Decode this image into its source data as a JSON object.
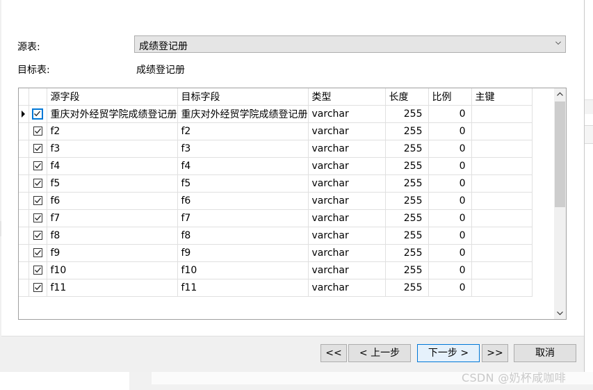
{
  "form": {
    "source_label": "源表:",
    "source_value": "成绩登记册",
    "target_label": "目标表:",
    "target_value": "成绩登记册"
  },
  "grid": {
    "columns": [
      "源字段",
      "目标字段",
      "类型",
      "长度",
      "比例",
      "主键"
    ],
    "rows": [
      {
        "checked": true,
        "source": "重庆对外经贸学院成绩登记册",
        "target": "重庆对外经贸学院成绩登记册",
        "type": "varchar",
        "length": "255",
        "scale": "0",
        "pk": ""
      },
      {
        "checked": true,
        "source": "f2",
        "target": "f2",
        "type": "varchar",
        "length": "255",
        "scale": "0",
        "pk": ""
      },
      {
        "checked": true,
        "source": "f3",
        "target": "f3",
        "type": "varchar",
        "length": "255",
        "scale": "0",
        "pk": ""
      },
      {
        "checked": true,
        "source": "f4",
        "target": "f4",
        "type": "varchar",
        "length": "255",
        "scale": "0",
        "pk": ""
      },
      {
        "checked": true,
        "source": "f5",
        "target": "f5",
        "type": "varchar",
        "length": "255",
        "scale": "0",
        "pk": ""
      },
      {
        "checked": true,
        "source": "f6",
        "target": "f6",
        "type": "varchar",
        "length": "255",
        "scale": "0",
        "pk": ""
      },
      {
        "checked": true,
        "source": "f7",
        "target": "f7",
        "type": "varchar",
        "length": "255",
        "scale": "0",
        "pk": ""
      },
      {
        "checked": true,
        "source": "f8",
        "target": "f8",
        "type": "varchar",
        "length": "255",
        "scale": "0",
        "pk": ""
      },
      {
        "checked": true,
        "source": "f9",
        "target": "f9",
        "type": "varchar",
        "length": "255",
        "scale": "0",
        "pk": ""
      },
      {
        "checked": true,
        "source": "f10",
        "target": "f10",
        "type": "varchar",
        "length": "255",
        "scale": "0",
        "pk": ""
      },
      {
        "checked": true,
        "source": "f11",
        "target": "f11",
        "type": "varchar",
        "length": "255",
        "scale": "0",
        "pk": ""
      }
    ]
  },
  "buttons": {
    "first": "<<",
    "prev": "< 上一步",
    "next": "下一步 >",
    "last": ">>",
    "cancel": "取消"
  },
  "watermark": "CSDN @奶杯咸咖啡",
  "colors": {
    "accent": "#0078d7",
    "combo_bg": "#e5e5e5",
    "footer_bg": "#f0f0f0"
  }
}
